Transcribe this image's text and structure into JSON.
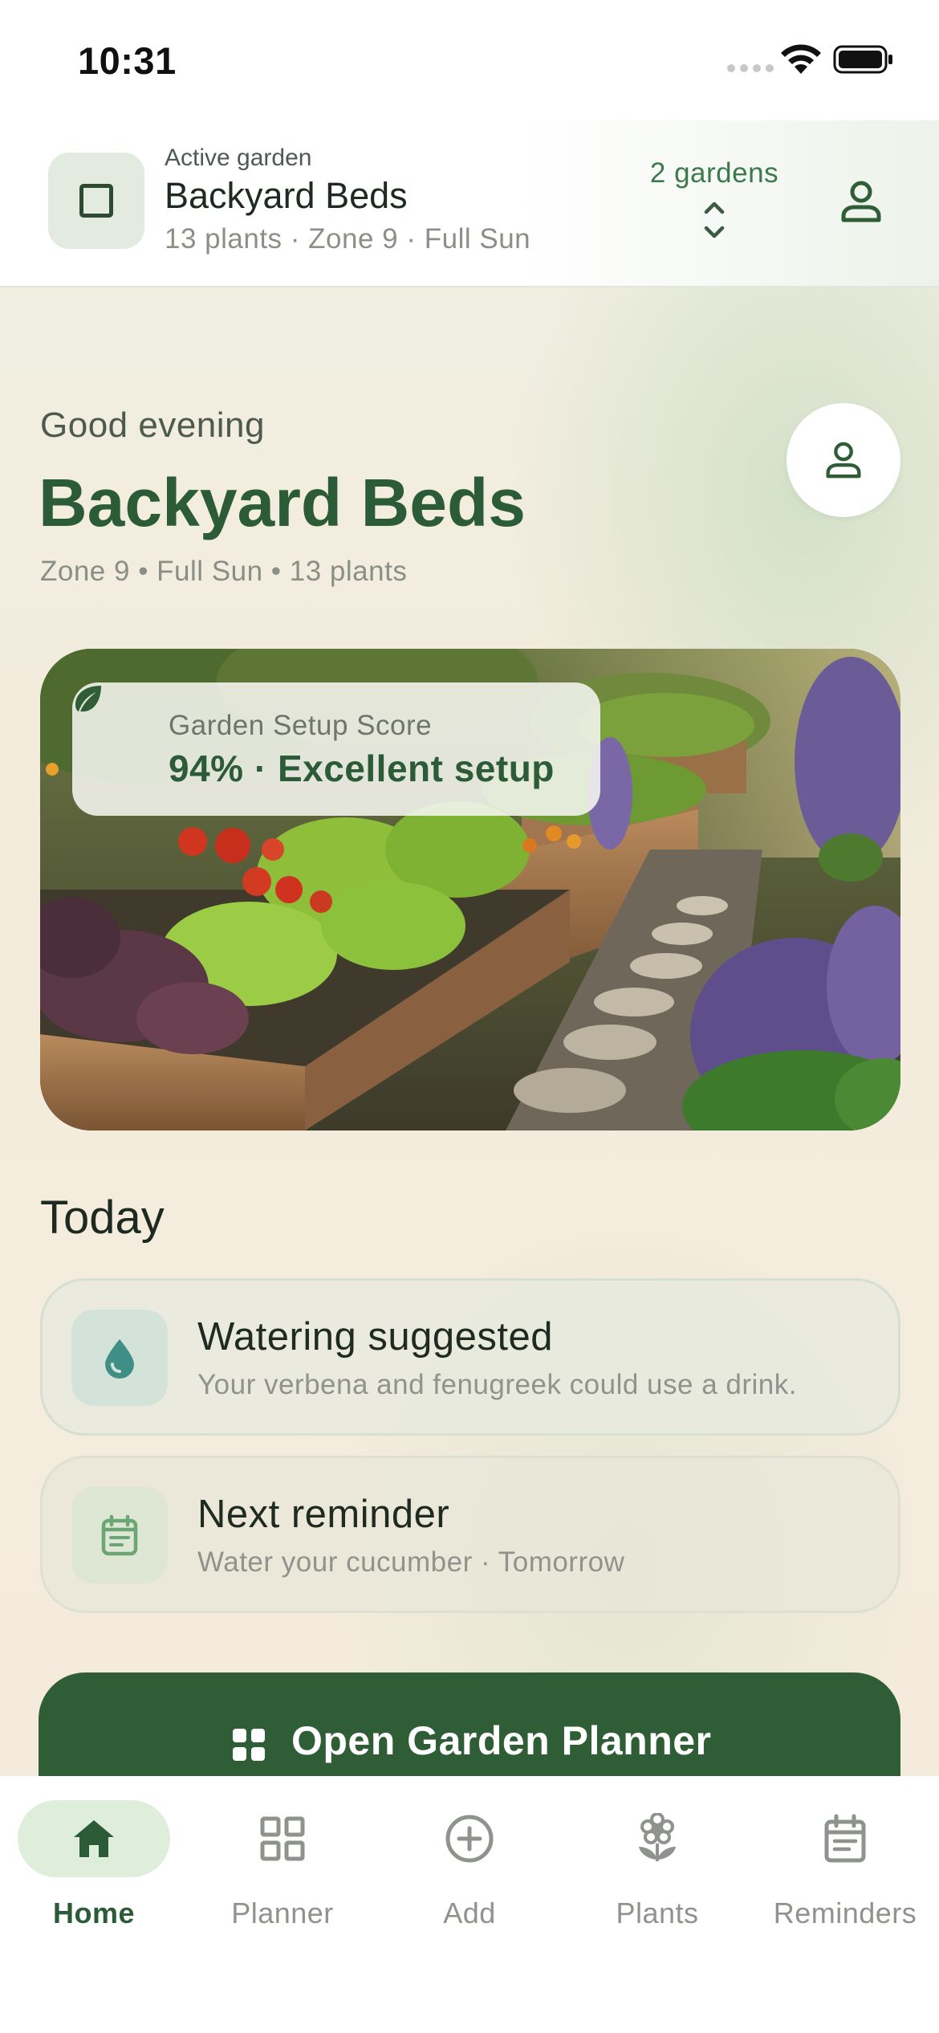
{
  "status_bar": {
    "time": "10:31"
  },
  "header": {
    "label": "Active garden",
    "title": "Backyard Beds",
    "subtitle": "13 plants · Zone 9 · Full Sun",
    "gardens_count": "2 gardens",
    "icons": {
      "badge": "square-icon",
      "switch": "chevron-up-down-icon",
      "profile": "person-icon"
    }
  },
  "greeting": {
    "salutation": "Good evening",
    "title": "Backyard Beds",
    "subtitle": "Zone 9 • Full Sun • 13 plants"
  },
  "hero": {
    "score_label": "Garden Setup Score",
    "score_value": "94% · Excellent setup",
    "score_percent": 94
  },
  "today": {
    "title": "Today",
    "cards": [
      {
        "title": "Watering suggested",
        "subtitle": "Your verbena and fenugreek could use a drink.",
        "icon": "water-drop-icon"
      },
      {
        "title": "Next reminder",
        "subtitle": "Water your cucumber · Tomorrow",
        "icon": "calendar-icon"
      }
    ]
  },
  "cta": {
    "label": "Open Garden Planner",
    "icon": "grid-icon"
  },
  "tabs": [
    {
      "label": "Home",
      "icon": "home-icon",
      "active": true
    },
    {
      "label": "Planner",
      "icon": "grid-icon",
      "active": false
    },
    {
      "label": "Add",
      "icon": "plus-circle-icon",
      "active": false
    },
    {
      "label": "Plants",
      "icon": "flower-icon",
      "active": false
    },
    {
      "label": "Reminders",
      "icon": "calendar-icon",
      "active": false
    }
  ],
  "colors": {
    "brand_green": "#2f5e36",
    "accent_green": "#3c7a4d",
    "water_teal": "#3f8f86",
    "background": "#f4ecdf"
  }
}
